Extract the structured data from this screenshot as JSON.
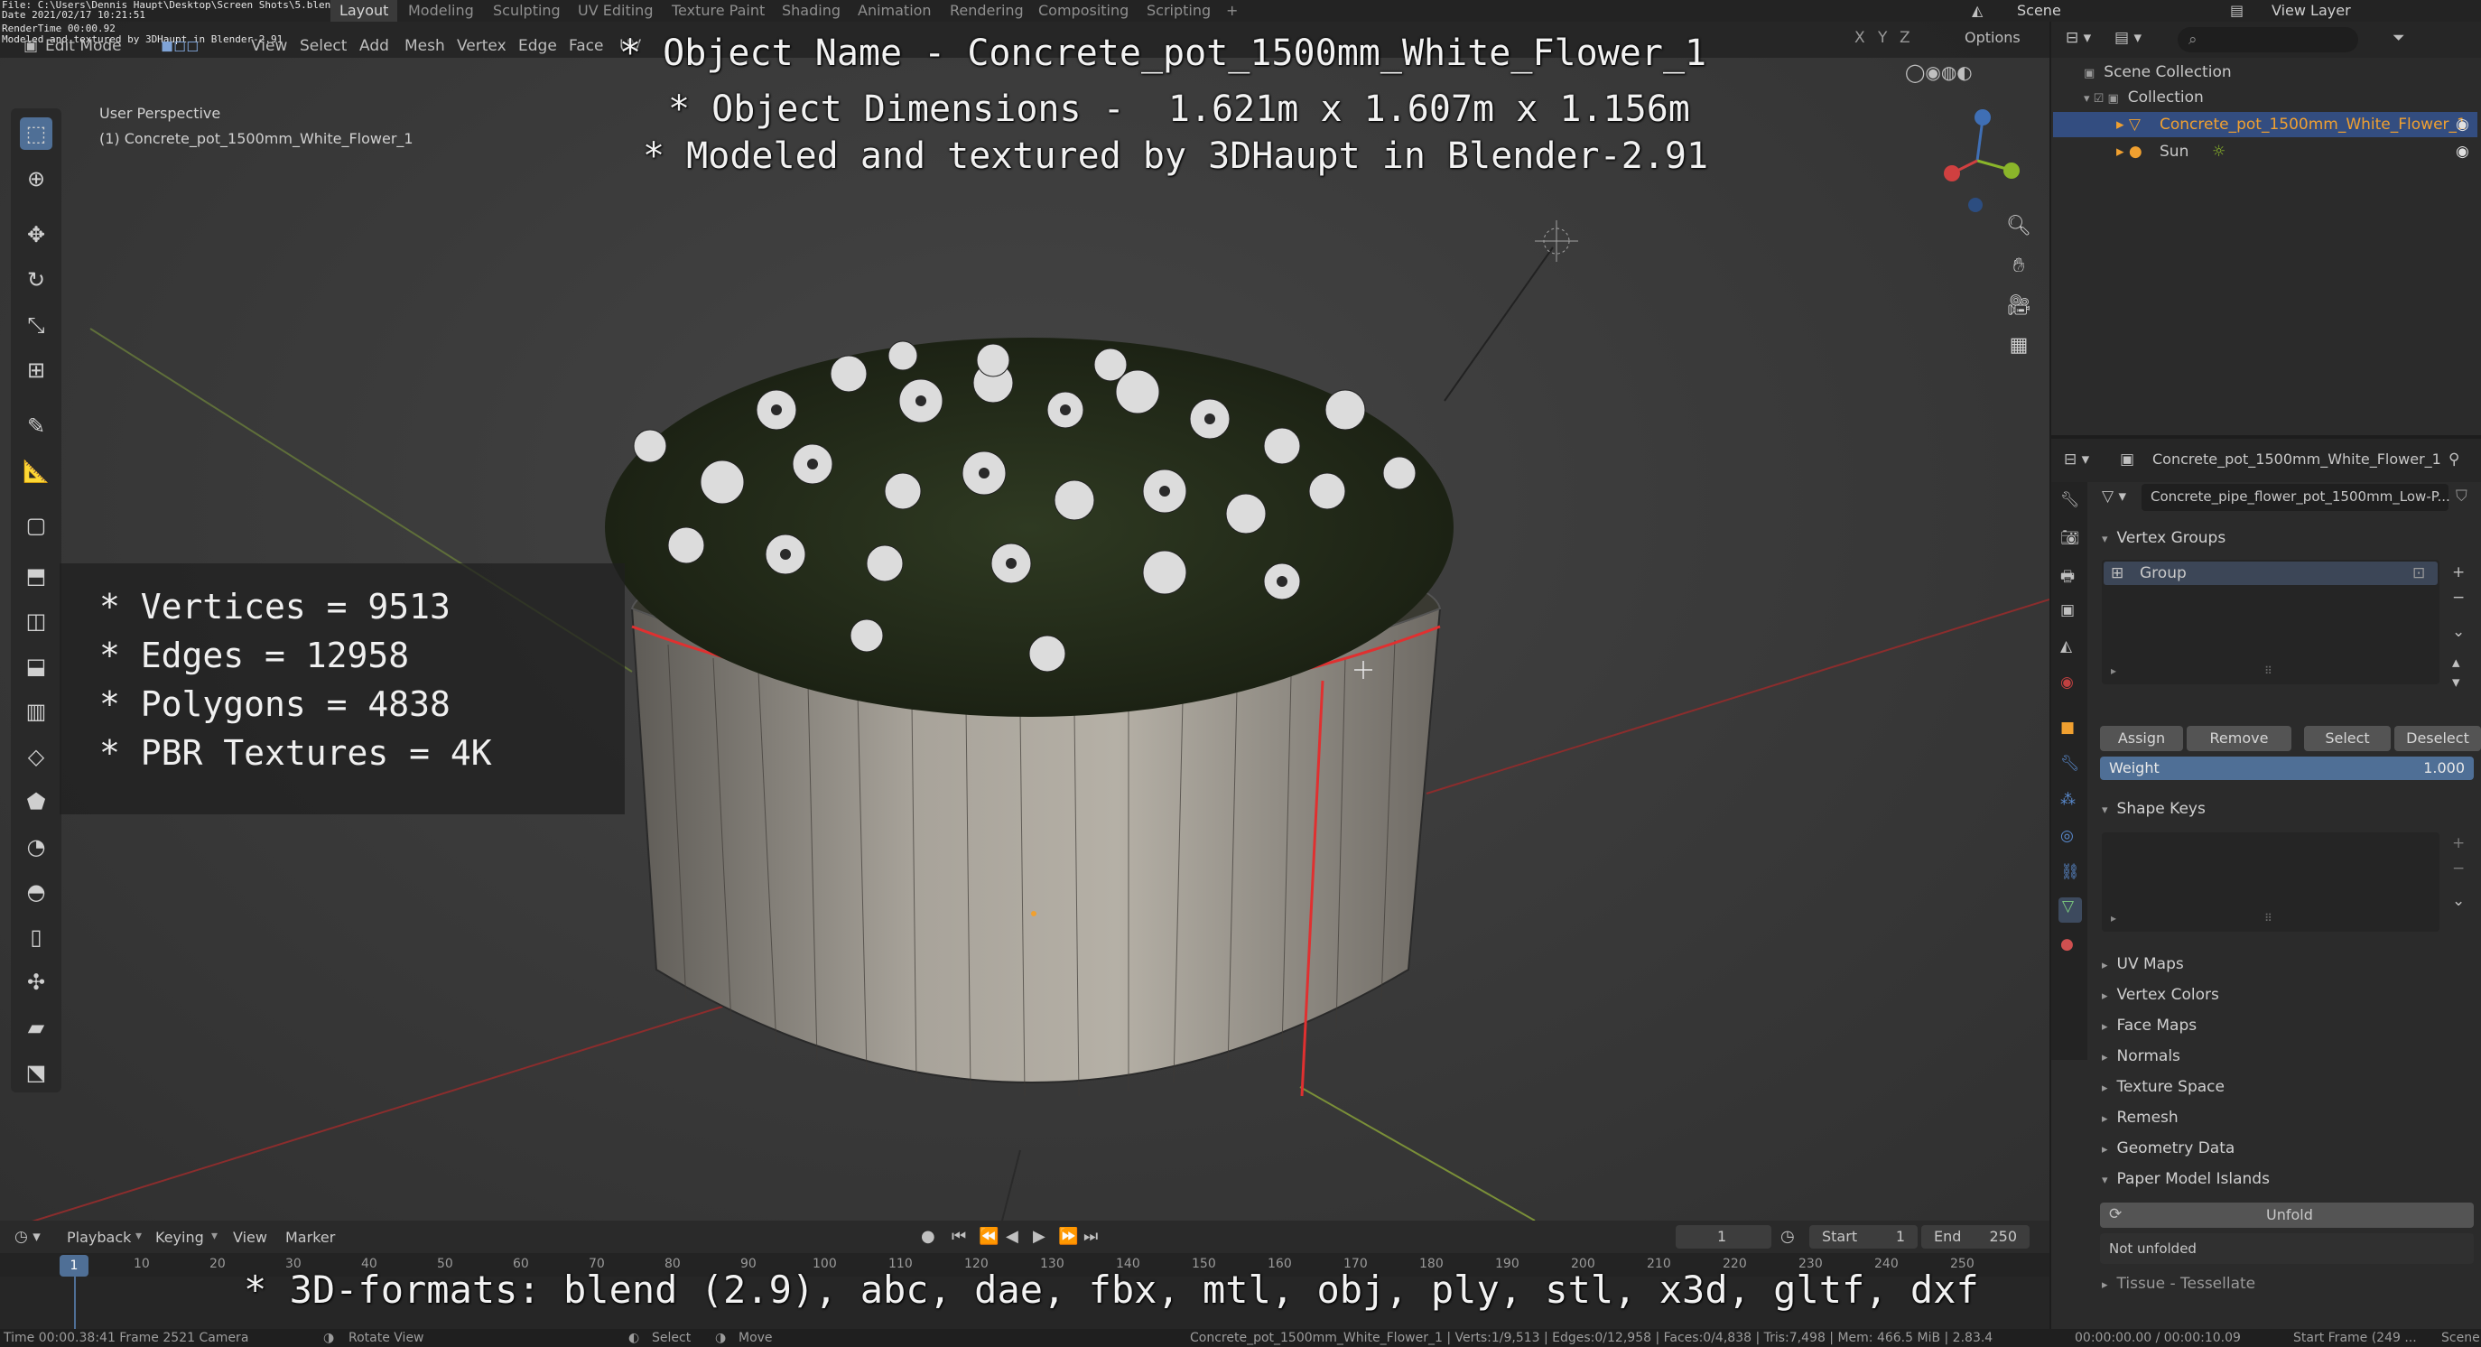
{
  "top_info": {
    "file": "File: C:\\Users\\Dennis Haupt\\Desktop\\Screen Shots\\5.blend",
    "date": "Date 2021/02/17 10:21:51",
    "render_time": "RenderTime 00:00.92",
    "modeled": "Modeled and textured by 3DHaupt in Blender-2.91"
  },
  "workspace_tabs": [
    "Layout",
    "Modeling",
    "Sculpting",
    "UV Editing",
    "Texture Paint",
    "Shading",
    "Animation",
    "Rendering",
    "Compositing",
    "Scripting"
  ],
  "workspace_active": "Layout",
  "scene": {
    "label": "Scene",
    "view_layer": "View Layer"
  },
  "viewport_header": {
    "mode": "Edit Mode",
    "menus": [
      "View",
      "Select",
      "Add",
      "Mesh",
      "Vertex",
      "Edge",
      "Face",
      "UV"
    ],
    "options": "Options",
    "axes": [
      "X",
      "Y",
      "Z"
    ]
  },
  "viewport_info": {
    "perspective": "User Perspective",
    "object": "(1) Concrete_pot_1500mm_White_Flower_1"
  },
  "overlay": {
    "name_line": "* Object Name - Concrete_pot_1500mm_White_Flower_1",
    "dims_line": "* Object Dimensions -  1.621m x 1.607m x 1.156m",
    "modeled_line": "* Modeled and textured by 3DHaupt in Blender-2.91",
    "vertices": "* Vertices = 9513",
    "edges": "* Edges = 12958",
    "polygons": "* Polygons = 4838",
    "textures": "* PBR Textures = 4K",
    "formats": "* 3D-formats: blend (2.9), abc, dae, fbx, mtl, obj, ply, stl, x3d, gltf, dxf"
  },
  "outliner": {
    "root": "Scene Collection",
    "collection": "Collection",
    "items": [
      "Concrete_pot_1500mm_White_Flower_1",
      "Sun"
    ]
  },
  "properties": {
    "object_name": "Concrete_pot_1500mm_White_Flower_1",
    "mesh_name": "Concrete_pipe_flower_pot_1500mm_Low-P...",
    "vertex_groups_title": "Vertex Groups",
    "group_item": "Group",
    "buttons": [
      "Assign",
      "Remove",
      "Select",
      "Deselect"
    ],
    "weight_label": "Weight",
    "weight_value": "1.000",
    "weight": 1.0,
    "shape_keys_title": "Shape Keys",
    "sections": [
      "UV Maps",
      "Vertex Colors",
      "Face Maps",
      "Normals",
      "Texture Space",
      "Remesh",
      "Geometry Data"
    ],
    "paper_model": "Paper Model Islands",
    "unfold_label": "Unfold",
    "not_unfolded": "Not unfolded",
    "tissue": "Tissue - Tessellate"
  },
  "timeline": {
    "menus": [
      "Playback",
      "Keying",
      "View",
      "Marker"
    ],
    "current_frame": "1",
    "start_label": "Start",
    "start_value": "1",
    "end_label": "End",
    "end_value": "250",
    "ticks": [
      "10",
      "20",
      "30",
      "40",
      "50",
      "60",
      "70",
      "80",
      "90",
      "100",
      "110",
      "120",
      "130",
      "140",
      "150",
      "160",
      "170",
      "180",
      "190",
      "200",
      "210",
      "220",
      "230",
      "240",
      "250"
    ]
  },
  "status": {
    "left": "Time 00:00.38:41  Frame 2521  Camera",
    "rotate": "Rotate View",
    "select": "Select",
    "move": "Move",
    "stats": "Concrete_pot_1500mm_White_Flower_1 | Verts:1/9,513 | Edges:0/12,958 | Faces:0/4,838 | Tris:7,498 | Mem: 466.5 MiB | 2.83.4",
    "time": "00:00:00.00 / 00:00:10.09",
    "start_frame": "Start Frame (249 ...",
    "scene": "Scene"
  },
  "colors": {
    "accent": "#4f6f96",
    "selected": "#334d80",
    "edge_red": "#e03030",
    "axis_green": "#8ab52a"
  }
}
